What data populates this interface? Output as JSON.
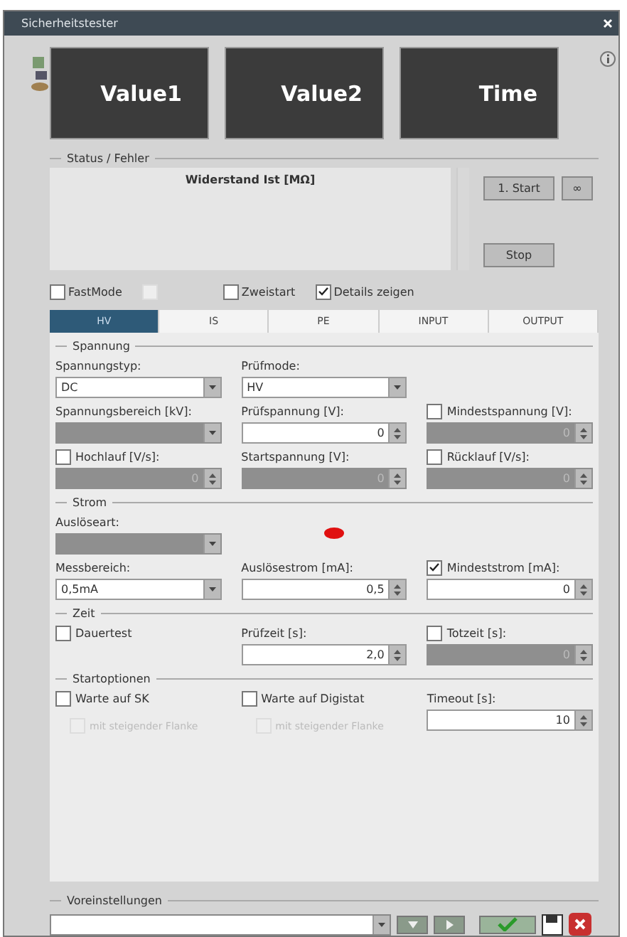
{
  "window": {
    "title": "Sicherheitstester"
  },
  "tiles": [
    "Value1",
    "Value2",
    "Time"
  ],
  "status": {
    "legend": "Status / Fehler",
    "heading": "Widerstand Ist [MΩ]",
    "buttons": [
      {
        "label": "1. Start",
        "kind": "wide"
      },
      {
        "label": "∞",
        "kind": "small"
      },
      {
        "label": "Stop",
        "kind": "wide"
      }
    ]
  },
  "options": [
    {
      "label": "FastMode",
      "checked": false,
      "disabled": false
    },
    {
      "checked": false,
      "disabled": true
    },
    {
      "label": "Zweistart",
      "checked": false,
      "disabled": false
    },
    {
      "label": "Details zeigen",
      "checked": true,
      "disabled": false
    }
  ],
  "tabs": [
    {
      "label": "HV",
      "selected": true
    },
    {
      "label": "IS",
      "selected": false
    },
    {
      "label": "PE",
      "selected": false
    },
    {
      "label": "INPUT",
      "selected": false
    },
    {
      "label": "OUTPUT",
      "selected": false
    }
  ],
  "sections": [
    {
      "legend": "Spannung",
      "rows": [
        [
          {
            "label": "Spannungstyp:",
            "kind": "dropdown",
            "value": "DC",
            "disabled": false
          },
          {
            "label": "Prüfmode:",
            "kind": "dropdown",
            "value": "HV",
            "disabled": false
          },
          null
        ],
        [
          {
            "label": "Spannungsbereich [kV]:",
            "kind": "dropdown",
            "disabled": true
          },
          {
            "label": "Prüfspannung [V]:",
            "kind": "spinner",
            "value": "0",
            "disabled": false
          },
          {
            "label": "Mindestspannung [V]:",
            "kind": "spinner",
            "value": "0",
            "disabled": true,
            "checked": false
          }
        ],
        [
          {
            "label": "Hochlauf [V/s]:",
            "kind": "spinner",
            "value": "0",
            "disabled": true,
            "checked": false
          },
          {
            "label": "Startspannung [V]:",
            "kind": "spinner",
            "value": "0",
            "disabled": true
          },
          {
            "label": "Rücklauf [V/s]:",
            "kind": "spinner",
            "value": "0",
            "disabled": true,
            "checked": false
          }
        ]
      ]
    },
    {
      "legend": "Strom",
      "rows": [
        [
          {
            "label": "Auslöseart:",
            "kind": "dropdown",
            "disabled": true
          },
          null,
          null
        ],
        [
          {
            "label": "Messbereich:",
            "kind": "dropdown",
            "value": "0,5mA",
            "disabled": false
          },
          {
            "label": "Auslösestrom [mA]:",
            "kind": "spinner",
            "value": "0,5",
            "disabled": false
          },
          {
            "label": "Mindeststrom [mA]:",
            "kind": "spinner",
            "value": "0",
            "disabled": false,
            "checked": true
          }
        ]
      ]
    },
    {
      "legend": "Zeit",
      "rows": [
        [
          {
            "label": "Dauertest",
            "kind": "check",
            "checked": false
          },
          {
            "label": "Prüfzeit [s]:",
            "kind": "spinner",
            "value": "2,0",
            "disabled": false
          },
          {
            "label": "Totzeit [s]:",
            "kind": "spinner",
            "value": "0",
            "disabled": true,
            "checked": false
          }
        ]
      ]
    },
    {
      "legend": "Startoptionen",
      "rows": [
        [
          {
            "label": "Warte auf SK",
            "kind": "check",
            "checked": false,
            "sub": {
              "label": "mit steigender Flanke",
              "checked": false,
              "disabled": true
            }
          },
          {
            "label": "Warte auf Digistat",
            "kind": "check",
            "checked": false,
            "sub": {
              "label": "mit steigender Flanke",
              "checked": false,
              "disabled": true
            }
          },
          {
            "label": "Timeout [s]:",
            "kind": "spinner",
            "value": "10",
            "disabled": false
          }
        ]
      ]
    }
  ],
  "presets": {
    "legend": "Voreinstellungen"
  }
}
